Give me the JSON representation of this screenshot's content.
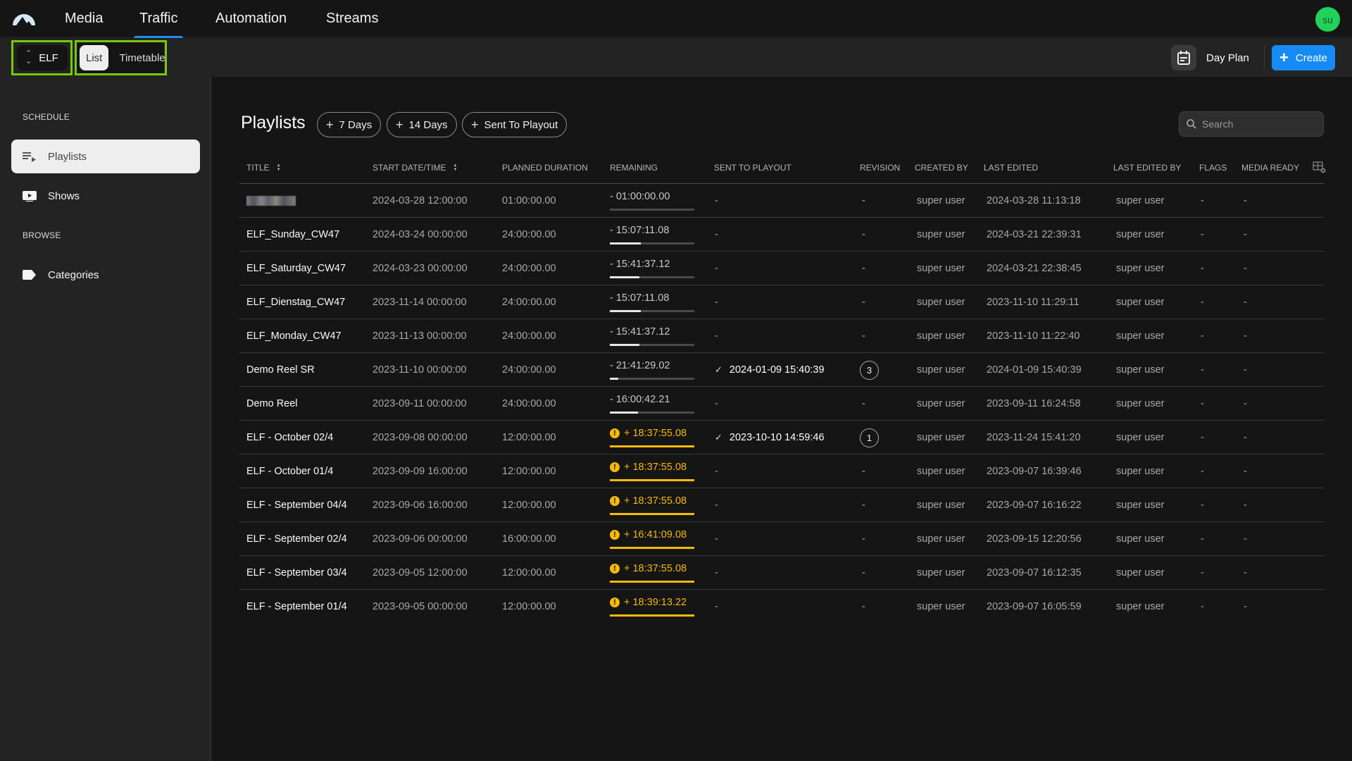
{
  "topnav": {
    "logo": "mountain-logo",
    "items": [
      {
        "label": "Media",
        "active": false
      },
      {
        "label": "Traffic",
        "active": true
      },
      {
        "label": "Automation",
        "active": false
      },
      {
        "label": "Streams",
        "active": false
      }
    ],
    "avatar_initials": "su",
    "avatar_color": "#22d15a"
  },
  "toolbar": {
    "channel": "ELF",
    "view_options": [
      "List",
      "Timetable"
    ],
    "active_view": "List",
    "day_plan_label": "Day Plan",
    "create_label": "Create",
    "accent": "#168bf5",
    "highlight_color": "#7ac70c"
  },
  "sidebar": {
    "sections": [
      {
        "label": "SCHEDULE",
        "items": [
          {
            "label": "Playlists",
            "icon": "playlist-icon",
            "active": true
          },
          {
            "label": "Shows",
            "icon": "video-icon",
            "active": false
          }
        ]
      },
      {
        "label": "BROWSE",
        "items": [
          {
            "label": "Categories",
            "icon": "label-icon",
            "active": false
          }
        ]
      }
    ]
  },
  "main": {
    "title": "Playlists",
    "filters": [
      "7 Days",
      "14 Days",
      "Sent To Playout"
    ],
    "search_placeholder": "Search"
  },
  "table": {
    "columns": [
      "TITLE",
      "START DATE/TIME",
      "PLANNED DURATION",
      "REMAINING",
      "SENT TO PLAYOUT",
      "REVISION",
      "CREATED BY",
      "LAST EDITED",
      "LAST EDITED BY",
      "FLAGS",
      "MEDIA READY"
    ],
    "rows": [
      {
        "title": "",
        "title_blurred": true,
        "start": "2024-03-28 12:00:00",
        "duration": "01:00:00.00",
        "remaining": "- 01:00:00.00",
        "remaining_fill": 0.0,
        "overrun": false,
        "sent": "-",
        "revision": "-",
        "created_by": "super user",
        "last_edited": "2024-03-28 11:13:18",
        "last_edited_by": "super user",
        "flags": "-",
        "media_ready": "-"
      },
      {
        "title": "ELF_Sunday_CW47",
        "start": "2024-03-24 00:00:00",
        "duration": "24:00:00.00",
        "remaining": "- 15:07:11.08",
        "remaining_fill": 0.37,
        "overrun": false,
        "sent": "-",
        "revision": "-",
        "created_by": "super user",
        "last_edited": "2024-03-21 22:39:31",
        "last_edited_by": "super user",
        "flags": "-",
        "media_ready": "-"
      },
      {
        "title": "ELF_Saturday_CW47",
        "start": "2024-03-23 00:00:00",
        "duration": "24:00:00.00",
        "remaining": "- 15:41:37.12",
        "remaining_fill": 0.35,
        "overrun": false,
        "sent": "-",
        "revision": "-",
        "created_by": "super user",
        "last_edited": "2024-03-21 22:38:45",
        "last_edited_by": "super user",
        "flags": "-",
        "media_ready": "-"
      },
      {
        "title": "ELF_Dienstag_CW47",
        "start": "2023-11-14 00:00:00",
        "duration": "24:00:00.00",
        "remaining": "- 15:07:11.08",
        "remaining_fill": 0.37,
        "overrun": false,
        "sent": "-",
        "revision": "-",
        "created_by": "super user",
        "last_edited": "2023-11-10 11:29:11",
        "last_edited_by": "super user",
        "flags": "-",
        "media_ready": "-"
      },
      {
        "title": "ELF_Monday_CW47",
        "start": "2023-11-13 00:00:00",
        "duration": "24:00:00.00",
        "remaining": "- 15:41:37.12",
        "remaining_fill": 0.35,
        "overrun": false,
        "sent": "-",
        "revision": "-",
        "created_by": "super user",
        "last_edited": "2023-11-10 11:22:40",
        "last_edited_by": "super user",
        "flags": "-",
        "media_ready": "-"
      },
      {
        "title": "Demo Reel SR",
        "start": "2023-11-10 00:00:00",
        "duration": "24:00:00.00",
        "remaining": "- 21:41:29.02",
        "remaining_fill": 0.1,
        "overrun": false,
        "sent": "2024-01-09 15:40:39",
        "revision": "3",
        "created_by": "super user",
        "last_edited": "2024-01-09 15:40:39",
        "last_edited_by": "super user",
        "flags": "-",
        "media_ready": "-"
      },
      {
        "title": "Demo Reel",
        "start": "2023-09-11 00:00:00",
        "duration": "24:00:00.00",
        "remaining": "- 16:00:42.21",
        "remaining_fill": 0.33,
        "overrun": false,
        "sent": "-",
        "revision": "-",
        "created_by": "super user",
        "last_edited": "2023-09-11 16:24:58",
        "last_edited_by": "super user",
        "flags": "-",
        "media_ready": "-"
      },
      {
        "title": "ELF - October 02/4",
        "start": "2023-09-08 00:00:00",
        "duration": "12:00:00.00",
        "remaining": "+ 18:37:55.08",
        "remaining_fill": 1.0,
        "overrun": true,
        "sent": "2023-10-10 14:59:46",
        "revision": "1",
        "created_by": "super user",
        "last_edited": "2023-11-24 15:41:20",
        "last_edited_by": "super user",
        "flags": "-",
        "media_ready": "-"
      },
      {
        "title": "ELF - October 01/4",
        "start": "2023-09-09 16:00:00",
        "duration": "12:00:00.00",
        "remaining": "+ 18:37:55.08",
        "remaining_fill": 1.0,
        "overrun": true,
        "sent": "-",
        "revision": "-",
        "created_by": "super user",
        "last_edited": "2023-09-07 16:39:46",
        "last_edited_by": "super user",
        "flags": "-",
        "media_ready": "-"
      },
      {
        "title": "ELF - September 04/4",
        "start": "2023-09-06 16:00:00",
        "duration": "12:00:00.00",
        "remaining": "+ 18:37:55.08",
        "remaining_fill": 1.0,
        "overrun": true,
        "sent": "-",
        "revision": "-",
        "created_by": "super user",
        "last_edited": "2023-09-07 16:16:22",
        "last_edited_by": "super user",
        "flags": "-",
        "media_ready": "-"
      },
      {
        "title": "ELF - September 02/4",
        "start": "2023-09-06 00:00:00",
        "duration": "16:00:00.00",
        "remaining": "+ 16:41:09.08",
        "remaining_fill": 1.0,
        "overrun": true,
        "sent": "-",
        "revision": "-",
        "created_by": "super user",
        "last_edited": "2023-09-15 12:20:56",
        "last_edited_by": "super user",
        "flags": "-",
        "media_ready": "-"
      },
      {
        "title": "ELF - September 03/4",
        "start": "2023-09-05 12:00:00",
        "duration": "12:00:00.00",
        "remaining": "+ 18:37:55.08",
        "remaining_fill": 1.0,
        "overrun": true,
        "sent": "-",
        "revision": "-",
        "created_by": "super user",
        "last_edited": "2023-09-07 16:12:35",
        "last_edited_by": "super user",
        "flags": "-",
        "media_ready": "-"
      },
      {
        "title": "ELF - September 01/4",
        "start": "2023-09-05 00:00:00",
        "duration": "12:00:00.00",
        "remaining": "+ 18:39:13.22",
        "remaining_fill": 1.0,
        "overrun": true,
        "sent": "-",
        "revision": "-",
        "created_by": "super user",
        "last_edited": "2023-09-07 16:05:59",
        "last_edited_by": "super user",
        "flags": "-",
        "media_ready": "-"
      }
    ]
  },
  "colors": {
    "overrun": "#f5b90a",
    "nav_active_underline": "#1e8ef0"
  }
}
